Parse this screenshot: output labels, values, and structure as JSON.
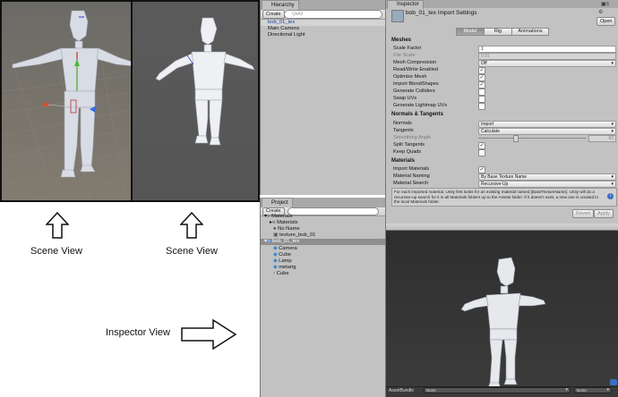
{
  "captions": {
    "scene_view_1": "Scene View",
    "scene_view_2": "Scene View",
    "inspector_view": "Inspector View"
  },
  "hierarchy": {
    "tab_label": "Hierarchy",
    "create_label": "Create",
    "search_placeholder": "Q▾All",
    "items": [
      "bob_01_tex",
      "Main Camera",
      "Directional Light"
    ]
  },
  "project": {
    "tab_label": "Project",
    "create_label": "Create",
    "tree": [
      {
        "label": "Materials",
        "level": 0
      },
      {
        "label": "Materials",
        "level": 1
      },
      {
        "label": "No Name",
        "level": 1
      },
      {
        "label": "texture_bob_01",
        "level": 1
      },
      {
        "label": "bob_01_tex",
        "level": 0,
        "selected": true
      },
      {
        "label": "Camera",
        "level": 1
      },
      {
        "label": "Cube",
        "level": 1
      },
      {
        "label": "Lamp",
        "level": 1
      },
      {
        "label": "metarig",
        "level": 1
      },
      {
        "label": "Cube",
        "level": 1
      }
    ]
  },
  "inspector": {
    "tab_label": "Inspector",
    "title": "bob_01_tex Import Settings",
    "open_label": "Open",
    "tabs": [
      "Model",
      "Rig",
      "Animations"
    ],
    "selected_tab": "Model",
    "meshes": {
      "header": "Meshes",
      "scale_factor_label": "Scale Factor",
      "scale_factor_value": "1",
      "file_scale_label": "File Scale",
      "file_scale_value": "0.01",
      "mesh_compression_label": "Mesh Compression",
      "mesh_compression_value": "Off",
      "read_write_label": "Read/Write Enabled",
      "read_write": true,
      "optimize_mesh_label": "Optimize Mesh",
      "optimize_mesh": true,
      "import_blendshapes_label": "Import BlendShapes",
      "import_blendshapes": true,
      "generate_colliders_label": "Generate Colliders",
      "generate_colliders": false,
      "swap_uvs_label": "Swap UVs",
      "swap_uvs": false,
      "lightmap_uvs_label": "Generate Lightmap UVs",
      "lightmap_uvs": false
    },
    "normals": {
      "header": "Normals & Tangents",
      "normals_label": "Normals",
      "normals_value": "Import",
      "tangents_label": "Tangents",
      "tangents_value": "Calculate",
      "smoothing_label": "Smoothing Angle",
      "smoothing_value": "60",
      "split_tangents_label": "Split Tangents",
      "split_tangents": true,
      "keep_quads_label": "Keep Quads",
      "keep_quads": false
    },
    "materials": {
      "header": "Materials",
      "import_materials_label": "Import Materials",
      "import_materials": true,
      "naming_label": "Material Naming",
      "naming_value": "By Base Texture Name",
      "search_label": "Material Search",
      "search_value": "Recursive-Up",
      "help_text": "For each imported material, Unity first looks for an existing material named [BaseTextureName]. Unity will do a recursive-up search for it in all Materials folders up to the Assets folder. If it doesn't exist, a new one is created in the local Materials folder."
    },
    "revert_label": "Revert",
    "apply_label": "Apply"
  },
  "preview": {
    "assetbundle_label": "AssetBundle",
    "bundle_value": "None",
    "variant_value": "None"
  }
}
